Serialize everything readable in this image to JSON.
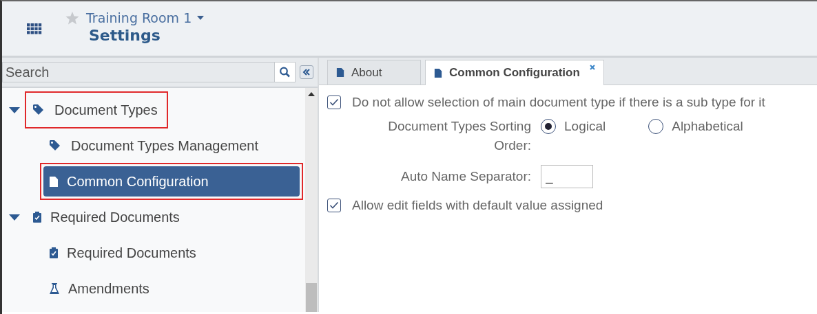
{
  "header": {
    "workspace": "Training Room 1",
    "title": "Settings",
    "favorite": false
  },
  "sidebar": {
    "search": {
      "placeholder": "Search"
    },
    "tree": [
      {
        "label": "Document Types",
        "kind": "tag",
        "expanded": true,
        "selected": false,
        "highlighted": true,
        "children": [
          {
            "label": "Document Types Management",
            "kind": "tag",
            "selected": false,
            "highlighted": false
          },
          {
            "label": "Common Configuration",
            "kind": "page",
            "selected": true,
            "highlighted": true
          }
        ]
      },
      {
        "label": "Required Documents",
        "kind": "clipboard",
        "expanded": true,
        "selected": false,
        "highlighted": false,
        "children": [
          {
            "label": "Required Documents",
            "kind": "clipboard",
            "selected": false,
            "highlighted": false
          },
          {
            "label": "Amendments",
            "kind": "flask",
            "selected": false,
            "highlighted": false
          }
        ]
      }
    ]
  },
  "tabs": [
    {
      "label": "About",
      "selected": false,
      "closable": false
    },
    {
      "label": "Common Configuration",
      "selected": true,
      "closable": true
    }
  ],
  "options": [
    {
      "kind": "checkbox",
      "label": "Do not allow selection of main document type if there is a sub type for it",
      "checked": true
    },
    {
      "kind": "radio",
      "label": "Document Types Sorting Order:",
      "choices": [
        {
          "label": "Logical",
          "selected": true
        },
        {
          "label": "Alphabetical",
          "selected": false
        }
      ]
    },
    {
      "kind": "text",
      "label": "Auto Name Separator:",
      "field": {
        "value": "_"
      }
    },
    {
      "kind": "checkbox",
      "label": "Allow edit fields with default value assigned",
      "checked": true
    }
  ]
}
